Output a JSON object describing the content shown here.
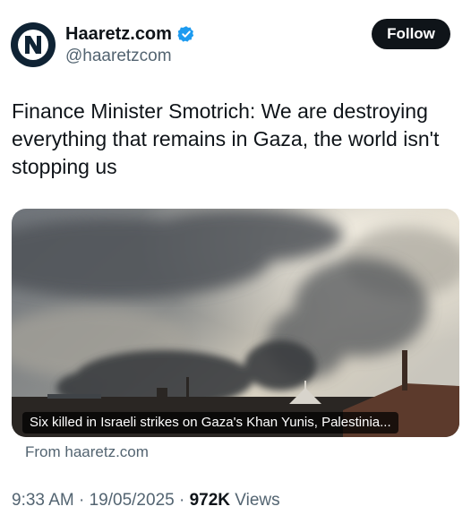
{
  "account": {
    "display_name": "Haaretz.com",
    "handle": "@haaretzcom",
    "verified": true,
    "avatar_icon": "haaretz-logo-icon"
  },
  "follow_button": {
    "label": "Follow"
  },
  "tweet": {
    "text": "Finance Minister Smotrich: We are destroying everything that remains in Gaza, the world isn't stopping us"
  },
  "link_card": {
    "caption": "Six killed in Israeli strikes on Gaza's Khan Yunis, Palestinia...",
    "source": "From haaretz.com"
  },
  "meta": {
    "time": "9:33 AM",
    "date": "19/05/2025",
    "separator": "·",
    "views_count": "972K",
    "views_label": "Views"
  },
  "colors": {
    "text": "#0f1419",
    "secondary": "#536471",
    "verified": "#1d9bf0",
    "avatar_bg": "#0f2334"
  }
}
